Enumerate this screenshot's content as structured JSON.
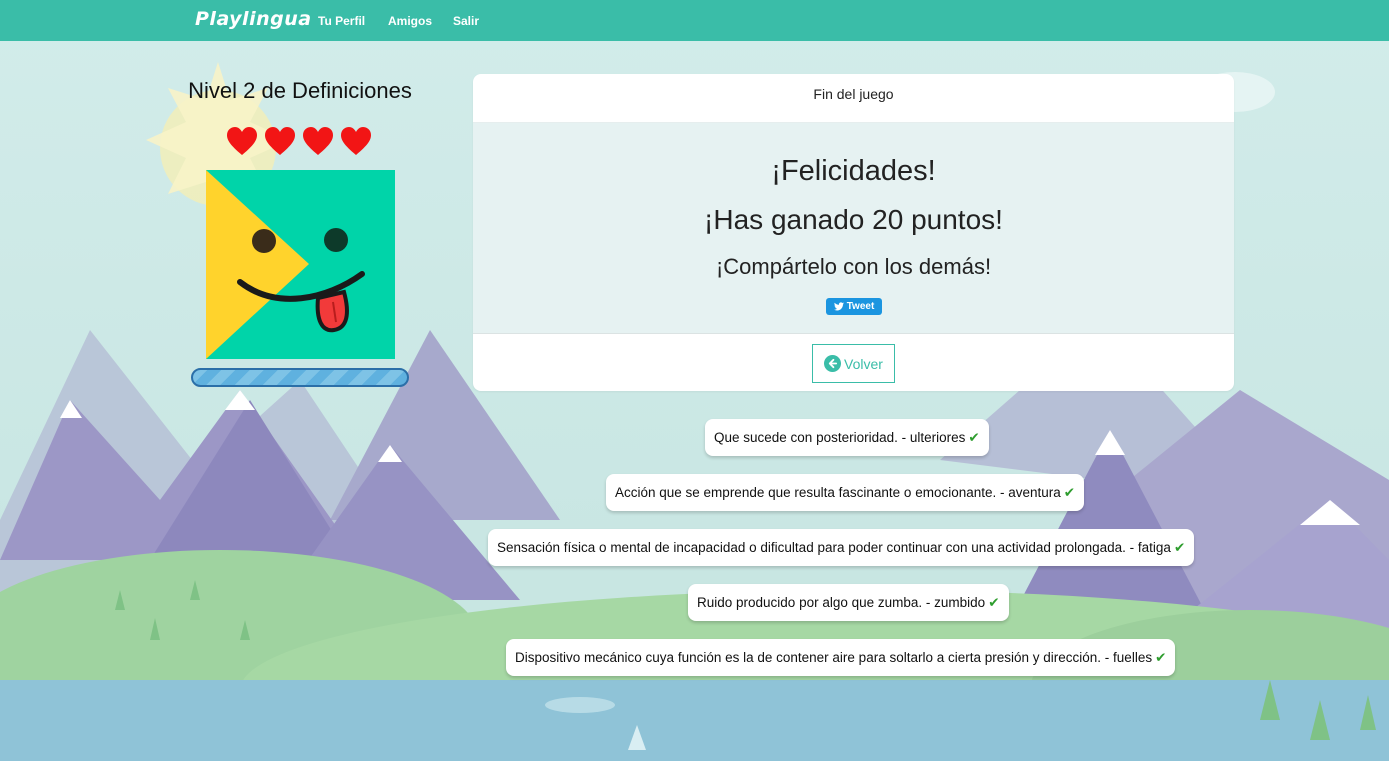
{
  "navbar": {
    "brand": "Playlingua",
    "links": [
      "Tu Perfil",
      "Amigos",
      "Salir"
    ],
    "color": "#3abda8"
  },
  "level": {
    "title": "Nivel 2 de Definiciones",
    "lives": 4
  },
  "panel": {
    "header": "Fin del juego",
    "congrats": "¡Felicidades!",
    "points": "¡Has ganado 20 puntos!",
    "share": "¡Compártelo con los demás!",
    "tweet_label": "Tweet",
    "back_label": "Volver"
  },
  "results": [
    {
      "text": "Que sucede con posterioridad. - ulteriores",
      "correct": true
    },
    {
      "text": "Acción que se emprende que resulta fascinante o emocionante. - aventura",
      "correct": true
    },
    {
      "text": "Sensación física o mental de incapacidad o dificultad para poder continuar con una actividad prolongada. - fatiga",
      "correct": true
    },
    {
      "text": "Ruido producido por algo que zumba. - zumbido",
      "correct": true
    },
    {
      "text": "Dispositivo mecánico cuya función es la de contener aire para soltarlo a cierta presión y dirección. - fuelles",
      "correct": true
    }
  ],
  "icons": {
    "check": "check-icon",
    "heart": "heart-icon",
    "back": "arrow-circle-left-icon",
    "twitter": "twitter-bird-icon"
  }
}
